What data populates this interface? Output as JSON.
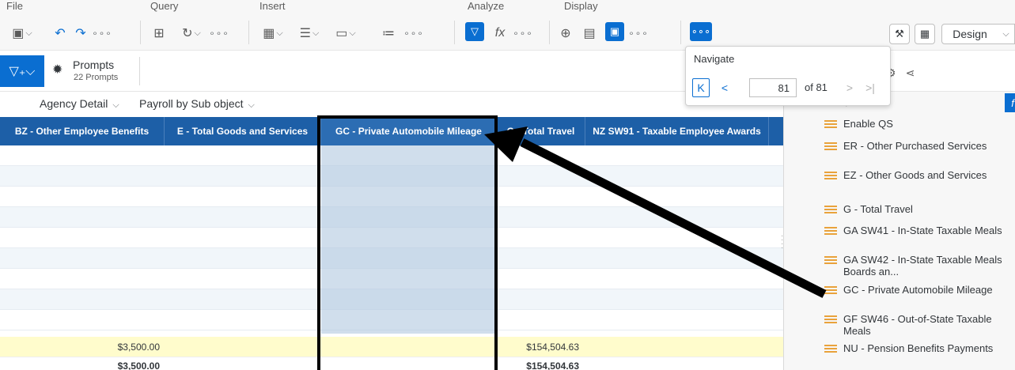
{
  "toolbar": {
    "groups": [
      "File",
      "Query",
      "Insert",
      "Analyze",
      "Display"
    ],
    "design_label": "Design"
  },
  "prompts": {
    "title": "Prompts",
    "subtitle": "22 Prompts"
  },
  "report_tabs": [
    {
      "label": "Agency Detail"
    },
    {
      "label": "Payroll by Sub object"
    }
  ],
  "navigate": {
    "title": "Navigate",
    "page": "81",
    "of_label": "of 81"
  },
  "grid": {
    "columns": [
      "BZ - Other Employee Benefits",
      "E - Total Goods and Services",
      "GC - Private Automobile Mileage",
      "G - Total Travel",
      "NZ SW91 - Taxable Employee Awards"
    ],
    "total_row": {
      "bz": "$3,500.00",
      "g": "$154,504.63"
    },
    "grand_total_row": {
      "bz": "$3,500.00",
      "g": "$154,504.63"
    }
  },
  "fields": [
    "Enable QS",
    "ER - Other Purchased Services",
    "EZ - Other Goods and Services",
    "G - Total Travel",
    "GA SW41 - In-State Taxable Meals",
    "GA SW42 - In-State Taxable Meals Boards an...",
    "GC - Private Automobile Mileage",
    "GF SW46 - Out-of-State Taxable Meals",
    "NU - Pension Benefits Payments"
  ],
  "colors": {
    "accent": "#0a6ed1",
    "header_bg": "#1d5fa7",
    "total_bg": "#fffccc",
    "selection": "#b0c8e0"
  }
}
